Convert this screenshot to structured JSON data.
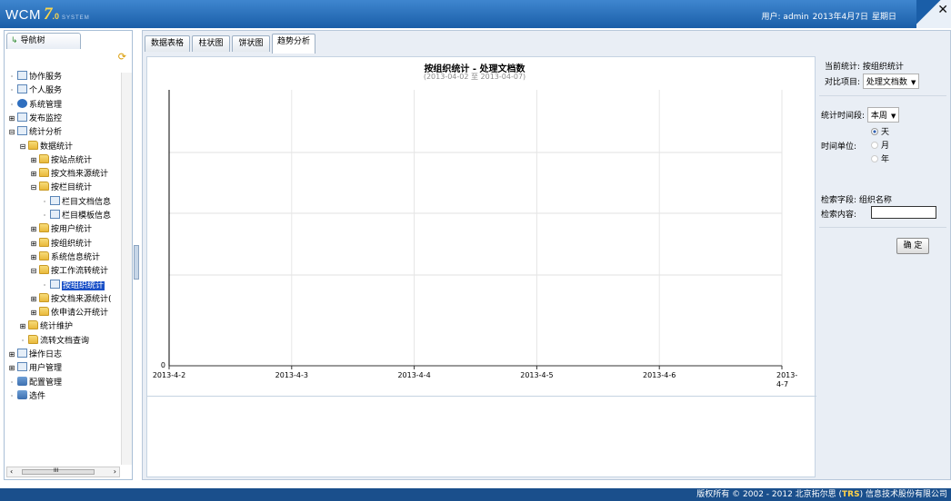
{
  "header": {
    "logo_text": "WCM",
    "logo_version": "7",
    "logo_version_small": ".0",
    "logo_sub": "SYSTEM",
    "user_label": "用户: admin",
    "date": "2013年4月7日",
    "weekday": "星期日",
    "close_glyph": "✕"
  },
  "sidebar": {
    "tab_label": "导航树",
    "tree": [
      {
        "label": "协作服务",
        "icon": "doc-icon",
        "glyph": "",
        "indent": 0
      },
      {
        "label": "个人服务",
        "icon": "doc-icon",
        "glyph": "",
        "indent": 0
      },
      {
        "label": "系统管理",
        "icon": "system-icon",
        "glyph": "",
        "indent": 0
      },
      {
        "label": "发布监控",
        "icon": "doc-icon",
        "glyph": "⊞",
        "indent": 0
      },
      {
        "label": "统计分析",
        "icon": "doc-icon",
        "glyph": "⊟",
        "indent": 0
      },
      {
        "label": "数据统计",
        "icon": "folder-icon",
        "glyph": "⊟",
        "indent": 1
      },
      {
        "label": "按站点统计",
        "icon": "folder-icon",
        "glyph": "⊞",
        "indent": 2
      },
      {
        "label": "按文档来源统计",
        "icon": "folder-icon",
        "glyph": "⊞",
        "indent": 2
      },
      {
        "label": "按栏目统计",
        "icon": "folder-icon",
        "glyph": "⊟",
        "indent": 2
      },
      {
        "label": "栏目文档信息",
        "icon": "doc-icon",
        "glyph": "",
        "indent": 3
      },
      {
        "label": "栏目模板信息",
        "icon": "doc-icon",
        "glyph": "",
        "indent": 3
      },
      {
        "label": "按用户统计",
        "icon": "folder-icon",
        "glyph": "⊞",
        "indent": 2
      },
      {
        "label": "按组织统计",
        "icon": "folder-icon",
        "glyph": "⊞",
        "indent": 2
      },
      {
        "label": "系统信息统计",
        "icon": "folder-icon",
        "glyph": "⊞",
        "indent": 2
      },
      {
        "label": "按工作流转统计",
        "icon": "folder-icon",
        "glyph": "⊟",
        "indent": 2
      },
      {
        "label": "按组织统计",
        "icon": "doc-icon",
        "glyph": "",
        "indent": 3,
        "selected": true
      },
      {
        "label": "按文档来源统计(",
        "icon": "folder-icon",
        "glyph": "⊞",
        "indent": 2
      },
      {
        "label": "依申请公开统计",
        "icon": "folder-icon",
        "glyph": "⊞",
        "indent": 2
      },
      {
        "label": "统计维护",
        "icon": "folder-icon",
        "glyph": "⊞",
        "indent": 1
      },
      {
        "label": "流转文档查询",
        "icon": "folder-icon",
        "glyph": "",
        "indent": 1
      },
      {
        "label": "操作日志",
        "icon": "doc-icon",
        "glyph": "⊞",
        "indent": 0
      },
      {
        "label": "用户管理",
        "icon": "doc-icon",
        "glyph": "⊞",
        "indent": 0
      },
      {
        "label": "配置管理",
        "icon": "manager-icon",
        "glyph": "",
        "indent": 0
      },
      {
        "label": "选件",
        "icon": "manager-icon",
        "glyph": "",
        "indent": 0
      }
    ],
    "hscroll_glyph": "III"
  },
  "tabs": [
    {
      "label": "数据表格"
    },
    {
      "label": "柱状图"
    },
    {
      "label": "饼状图"
    },
    {
      "label": "趋势分析"
    }
  ],
  "chart_data": {
    "type": "line",
    "title": "按组织统计 - 处理文档数",
    "subtitle": "(2013-04-02 至 2013-04-07)",
    "categories": [
      "2013-4-2",
      "2013-4-3",
      "2013-4-4",
      "2013-4-5",
      "2013-4-6",
      "2013-4-7"
    ],
    "series": [],
    "ytick_labels": [
      "0"
    ],
    "xlabel": "",
    "ylabel": "",
    "grid": true
  },
  "options": {
    "current_label": "当前统计:",
    "current_value": "按组织统计",
    "compare_label": "对比项目:",
    "compare_value": "处理文档数",
    "period_label": "统计时间段:",
    "period_value": "本周",
    "unit_label": "时间单位:",
    "unit_options": [
      "天",
      "月",
      "年"
    ],
    "unit_selected": "天",
    "field_label": "检索字段:",
    "field_value": "组织名称",
    "content_label": "检索内容:",
    "content_value": "",
    "confirm_label": "确 定"
  },
  "footer": {
    "text_before": "版权所有 © 2002 - 2012 北京拓尔思",
    "brand": "TRS",
    "text_after": "信息技术股份有限公司"
  }
}
